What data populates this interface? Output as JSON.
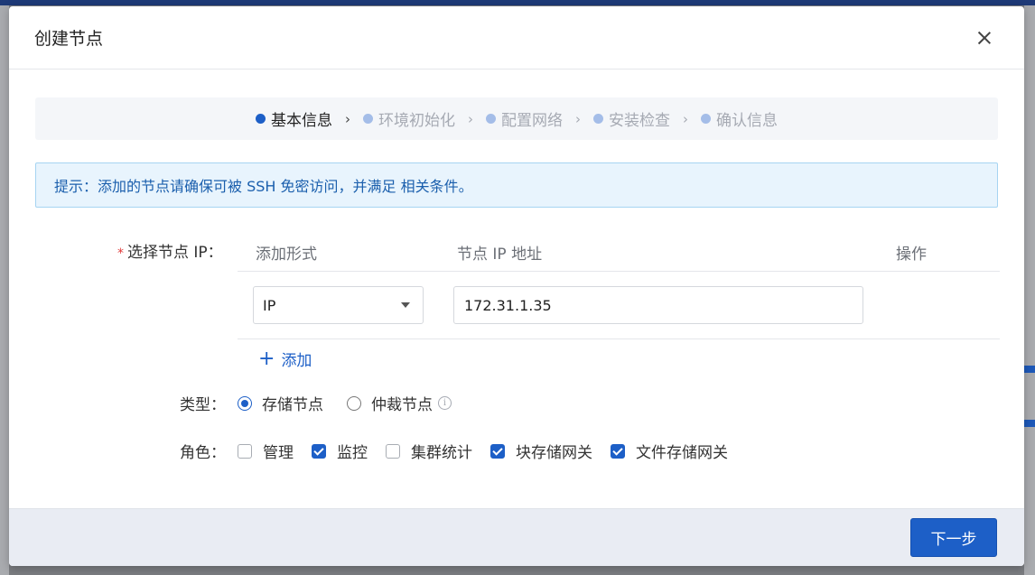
{
  "dialog": {
    "title": "创建节点"
  },
  "steps": [
    {
      "label": "基本信息",
      "active": true,
      "dot_color": "#1d5fc7"
    },
    {
      "label": "环境初始化",
      "active": false,
      "dot_color": "#a4bde8"
    },
    {
      "label": "配置网络",
      "active": false,
      "dot_color": "#a4bde8"
    },
    {
      "label": "安装检查",
      "active": false,
      "dot_color": "#a4bde8"
    },
    {
      "label": "确认信息",
      "active": false,
      "dot_color": "#a4bde8"
    }
  ],
  "step_separator": "›",
  "alert": {
    "text": "提示：添加的节点请确保可被 SSH 免密访问，并满足  相关条件。"
  },
  "form": {
    "ip_label": "选择节点 IP：",
    "required_mark": "*",
    "table": {
      "headers": {
        "mode": "添加形式",
        "ip": "节点 IP 地址",
        "actions": "操作"
      },
      "rows": [
        {
          "mode": "IP",
          "ip": "172.31.1.35"
        }
      ]
    },
    "add_label": "添加",
    "type_label": "类型：",
    "type_options": [
      {
        "label": "存储节点",
        "checked": true
      },
      {
        "label": "仲裁节点",
        "checked": false
      }
    ],
    "role_label": "角色：",
    "role_options": [
      {
        "label": "管理",
        "checked": false
      },
      {
        "label": "监控",
        "checked": true
      },
      {
        "label": "集群统计",
        "checked": false
      },
      {
        "label": "块存储网关",
        "checked": true
      },
      {
        "label": "文件存储网关",
        "checked": true
      }
    ]
  },
  "footer": {
    "next_label": "下一步"
  },
  "colors": {
    "primary": "#1d5fc7",
    "alert_bg": "#e8f4fd",
    "alert_text": "#1b5fad",
    "required": "#e03a3a"
  }
}
